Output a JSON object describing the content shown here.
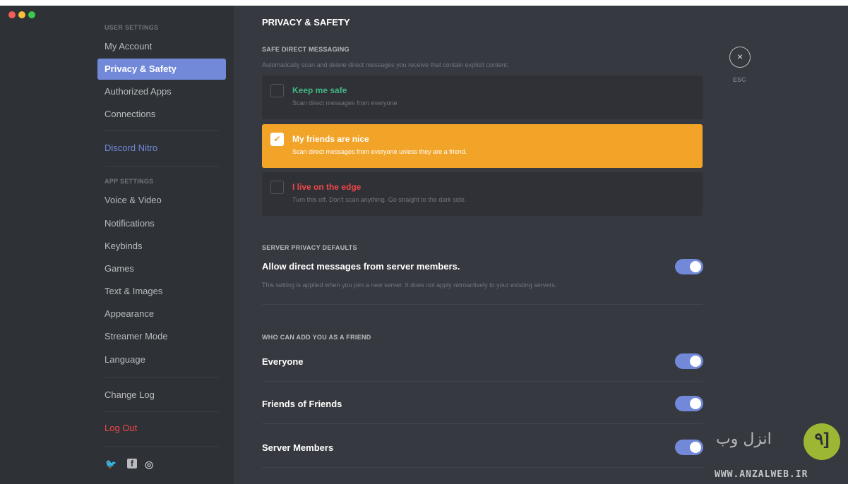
{
  "window": {
    "traffic_lights": [
      "#f25f58",
      "#fbbe3b",
      "#3ac94a"
    ]
  },
  "sidebar": {
    "user_settings_header": "USER SETTINGS",
    "user_items": [
      {
        "label": "My Account"
      },
      {
        "label": "Privacy & Safety",
        "active": true
      },
      {
        "label": "Authorized Apps"
      },
      {
        "label": "Connections"
      }
    ],
    "nitro_label": "Discord Nitro",
    "app_settings_header": "APP SETTINGS",
    "app_items": [
      {
        "label": "Voice & Video"
      },
      {
        "label": "Notifications"
      },
      {
        "label": "Keybinds"
      },
      {
        "label": "Games"
      },
      {
        "label": "Text & Images"
      },
      {
        "label": "Appearance"
      },
      {
        "label": "Streamer Mode"
      },
      {
        "label": "Language"
      }
    ],
    "change_log_label": "Change Log",
    "logout_label": "Log Out",
    "social": {
      "twitter_glyph": "🐦",
      "facebook_glyph": "f",
      "instagram_glyph": "◎"
    },
    "colors": {
      "active_bg": "#7289da",
      "nitro": "#7289da",
      "logout": "#f04747"
    }
  },
  "main": {
    "title": "PRIVACY & SAFETY",
    "safe_dm": {
      "header": "SAFE DIRECT MESSAGING",
      "description": "Automatically scan and delete direct messages you receive that contain explicit content.",
      "options": [
        {
          "label": "Keep me safe",
          "desc": "Scan direct messages from everyone",
          "checked": false,
          "label_color": "#43b581"
        },
        {
          "label": "My friends are nice",
          "desc": "Scan direct messages from everyone unless they are a friend.",
          "checked": true,
          "label_color": "#ffffff"
        },
        {
          "label": "I live on the edge",
          "desc": "Turn this off. Don't scan anything. Go straight to the dark side.",
          "checked": false,
          "label_color": "#f04747"
        }
      ],
      "selected_color": "#f2a428"
    },
    "server_privacy": {
      "header": "SERVER PRIVACY DEFAULTS",
      "label": "Allow direct messages from server members.",
      "desc": "This setting is applied when you join a new server. It does not apply retroactively to your existing servers.",
      "enabled": true
    },
    "friend_requests": {
      "header": "WHO CAN ADD YOU AS A FRIEND",
      "items": [
        {
          "label": "Everyone",
          "enabled": true
        },
        {
          "label": "Friends of Friends",
          "enabled": true
        },
        {
          "label": "Server Members",
          "enabled": true
        }
      ]
    },
    "close": {
      "icon": "×",
      "label": "ESC"
    },
    "toggle_color": "#7289da"
  },
  "watermark": {
    "arabic": "انزل وب",
    "badge": "٩]",
    "url": "WWW.ANZALWEB.IR",
    "badge_color": "#9bb733"
  }
}
